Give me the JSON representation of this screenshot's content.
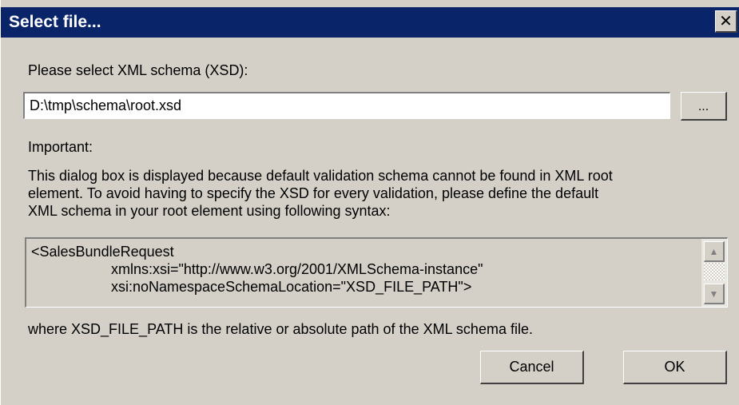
{
  "window": {
    "title": "Select file...",
    "close_symbol": "✕"
  },
  "schema_prompt": "Please select XML schema (XSD):",
  "path_field": {
    "value": "D:\\tmp\\schema\\root.xsd"
  },
  "browse_button": {
    "label": "..."
  },
  "important_heading": "Important:",
  "info_lines": [
    "This dialog box is displayed because default validation schema cannot be found in XML root",
    "element. To avoid having to specify the XSD for every validation, please define the default",
    "XML schema in your root element using following syntax:"
  ],
  "code_lines": [
    "<SalesBundleRequest",
    "xmlns:xsi=\"http://www.w3.org/2001/XMLSchema-instance\"",
    "xsi:noNamespaceSchemaLocation=\"XSD_FILE_PATH\">"
  ],
  "scroll": {
    "up_symbol": "▲",
    "down_symbol": "▼"
  },
  "footer_note": "where XSD_FILE_PATH is the relative or absolute path of the XML schema file.",
  "buttons": {
    "cancel": "Cancel",
    "ok": "OK"
  },
  "colors": {
    "titlebar": "#0a246a",
    "face": "#d4d0c8"
  }
}
